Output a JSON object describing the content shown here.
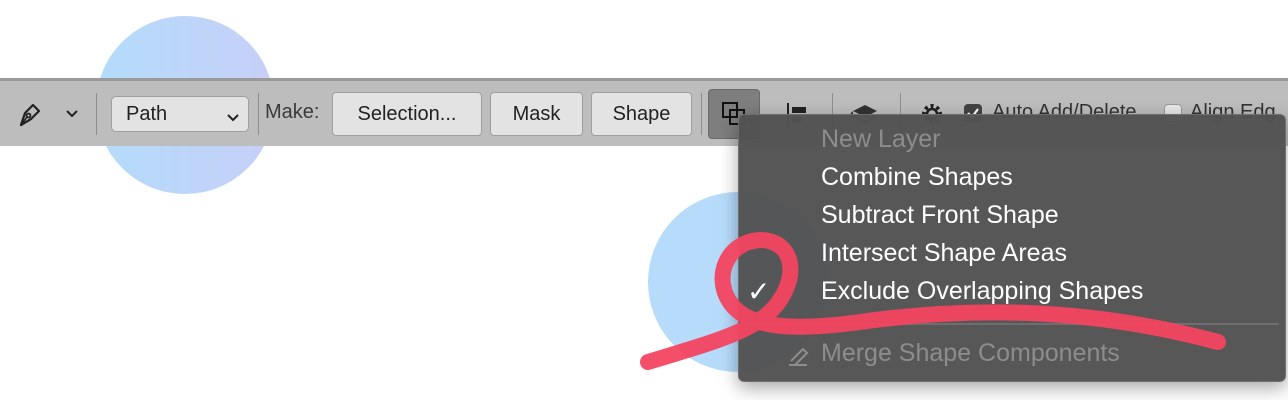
{
  "toolbar": {
    "mode_select": {
      "value": "Path"
    },
    "make_label": "Make:",
    "buttons": {
      "selection": "Selection...",
      "mask": "Mask",
      "shape": "Shape"
    },
    "auto_add_delete": {
      "label": "Auto Add/Delete",
      "checked": true
    },
    "align_edges": {
      "label": "Align Edg",
      "checked": false
    }
  },
  "menu": {
    "items": [
      {
        "label": "New Layer",
        "enabled": false,
        "checked": false
      },
      {
        "label": "Combine Shapes",
        "enabled": true,
        "checked": false
      },
      {
        "label": "Subtract Front Shape",
        "enabled": true,
        "checked": false
      },
      {
        "label": "Intersect Shape Areas",
        "enabled": true,
        "checked": false
      },
      {
        "label": "Exclude Overlapping Shapes",
        "enabled": true,
        "checked": true
      }
    ],
    "merge": {
      "label": "Merge Shape Components",
      "enabled": false
    },
    "checkmark": "✓"
  },
  "colors": {
    "toolbar_bg": "#bdbdbd",
    "menu_bg": "#525252",
    "highlight_scribble": "#f34560",
    "circle_blue": "#b6dbfb"
  },
  "icons": [
    "pen-tool-icon",
    "chevron-down-icon",
    "path-operations-icon",
    "path-alignment-icon",
    "path-arrangement-icon",
    "gear-icon",
    "checkmark-icon",
    "merge-components-icon"
  ]
}
